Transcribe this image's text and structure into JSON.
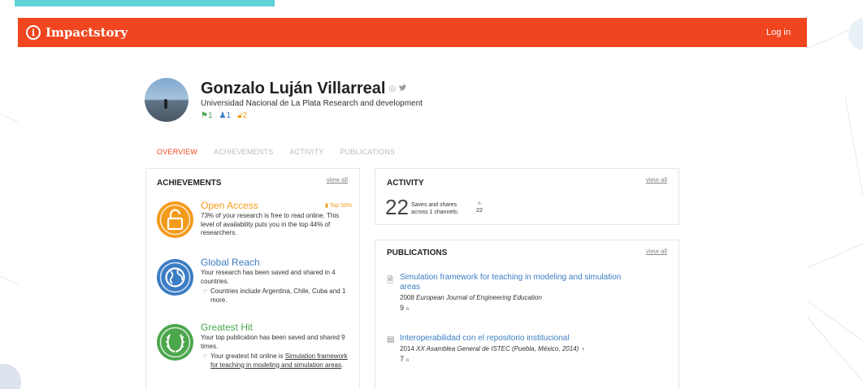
{
  "header": {
    "brand_icon": "i",
    "brand_name": "Impactstory",
    "login_label": "Log in",
    "bar_color": "#f0461f"
  },
  "profile": {
    "name": "Gonzalo Luján Villarreal",
    "affiliation": "Universidad Nacional de La Plata Research and development",
    "stats": {
      "growth_icon": "megaphone-icon",
      "growth_count": "1",
      "people_count": "1",
      "openaccess_count": "2"
    }
  },
  "tabs": [
    "OVERVIEW",
    "ACHIEVEMENTS",
    "ACTIVITY",
    "PUBLICATIONS"
  ],
  "achievements": {
    "title": "ACHIEVEMENTS",
    "view_all": "view all",
    "items": [
      {
        "title": "Open Access",
        "rank": "Top 50%",
        "desc": "73% of your research is free to read online. This level of availability puts you in the top 44% of researchers.",
        "color": "#f39b1a",
        "icon": "lock-open-icon"
      },
      {
        "title": "Global Reach",
        "desc": "Your research has been saved and shared in 4 countries.",
        "note": "Countries include Argentina, Chile, Cuba and 1 more.",
        "color": "#3b7dc4",
        "icon": "globe-icon"
      },
      {
        "title": "Greatest Hit",
        "desc": "Your top publication has been saved and shared 9 times.",
        "note_prefix": "Your greatest hit online is ",
        "note_link": "Simulation framework for teaching in modeling and simulation areas",
        "note_suffix": ".",
        "color": "#4ca64c",
        "icon": "laurel-icon"
      }
    ]
  },
  "activity": {
    "title": "ACTIVITY",
    "view_all": "view all",
    "count": "22",
    "label_line1": "Saves and shares",
    "label_line2": "across 1 channels:",
    "channel_count": "22"
  },
  "publications": {
    "title": "PUBLICATIONS",
    "view_all": "view all",
    "items": [
      {
        "title": "Simulation framework for teaching in modeling and simulation areas",
        "year": "2008",
        "venue": "European Journal of Engineering Education",
        "count": "9"
      },
      {
        "title": "Interoperabilidad con el repositorio institucional",
        "year": "2014",
        "venue": "XX Asamblea General de ISTEC (Puebla, México, 2014)",
        "count": "7"
      }
    ]
  }
}
